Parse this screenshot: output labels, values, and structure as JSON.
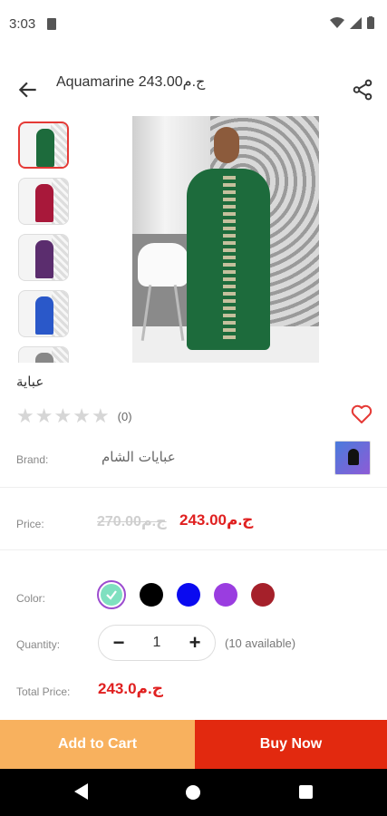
{
  "status_bar": {
    "time": "3:03"
  },
  "header": {
    "title": "Aquamarine 243.00ج.م"
  },
  "gallery": {
    "thumbnail_colors": [
      "#1d6b3c",
      "#a8183a",
      "#5b2d6e",
      "#2a58c9",
      "#888888"
    ]
  },
  "product": {
    "name": "عباية",
    "rating_count": "(0)"
  },
  "brand": {
    "label": "Brand:",
    "value": "عبايات الشام"
  },
  "price": {
    "label": "Price:",
    "old": "270.00ج.م",
    "current": "243.00ج.م"
  },
  "color": {
    "label": "Color:",
    "swatches": [
      "#7fe0c0",
      "#000000",
      "#0a0af0",
      "#9a3de0",
      "#a5202a"
    ],
    "selected_index": 0
  },
  "quantity": {
    "label": "Quantity:",
    "value": "1",
    "available": "(10 available)",
    "minus": "−",
    "plus": "+"
  },
  "total": {
    "label": "Total Price:",
    "value": "243.0ج.م"
  },
  "actions": {
    "add_to_cart": "Add to Cart",
    "buy_now": "Buy Now"
  }
}
